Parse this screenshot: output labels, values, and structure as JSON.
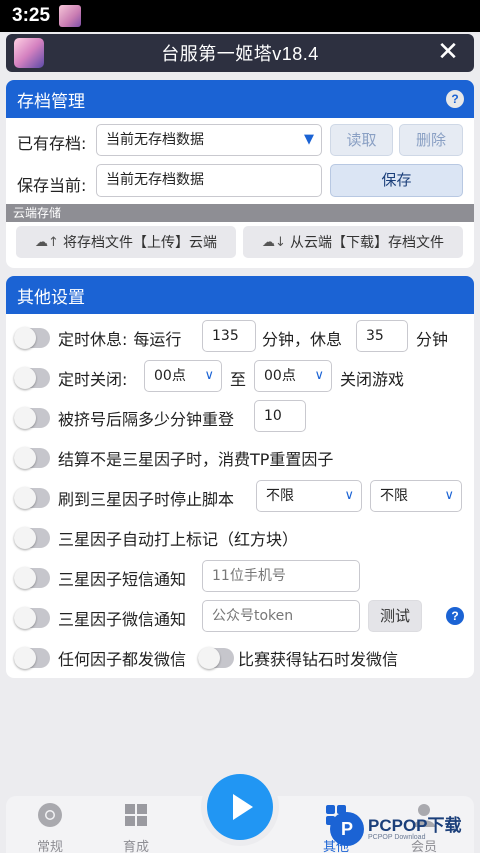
{
  "status_bar": {
    "time": "3:25"
  },
  "titlebar": {
    "title": "台服第一姬塔v18.4",
    "close_glyph": "✕"
  },
  "save_panel": {
    "title": "存档管理",
    "existing_label": "已有存档:",
    "existing_value": "当前无存档数据",
    "read_button": "读取",
    "delete_button": "删除",
    "save_current_label": "保存当前:",
    "save_current_value": "当前无存档数据",
    "save_button": "保存",
    "cloud_title": "云端存储",
    "upload_button": "将存档文件【上传】云端",
    "download_button": "从云端【下载】存档文件"
  },
  "other_panel": {
    "title": "其他设置",
    "timed_rest": {
      "label": "定时休息:",
      "every_label": "每运行",
      "run_minutes": "135",
      "minutes_rest_label": "分钟，休息",
      "rest_minutes": "35",
      "minutes_label": "分钟"
    },
    "timed_close": {
      "label": "定时关闭:",
      "from_value": "00点",
      "to_label": "至",
      "to_value": "00点",
      "suffix": "关闭游戏"
    },
    "relogin": {
      "label": "被挤号后隔多少分钟重登",
      "value": "10"
    },
    "settlement": {
      "label": "结算不是三星因子时，消费TP重置因子"
    },
    "stop_script": {
      "label": "刷到三星因子时停止脚本",
      "option1": "不限",
      "option2": "不限"
    },
    "auto_mark": {
      "label": "三星因子自动打上标记（红方块）"
    },
    "sms_notify": {
      "label": "三星因子短信通知",
      "placeholder": "11位手机号"
    },
    "wechat_notify": {
      "label": "三星因子微信通知",
      "placeholder": "公众号token",
      "test_button": "测试"
    },
    "any_factor": {
      "label": "任何因子都发微信"
    },
    "diamond": {
      "label": "比赛获得钻石时发微信"
    }
  },
  "bottom_nav": {
    "items": [
      {
        "label": "常规"
      },
      {
        "label": "育成"
      },
      {
        "label": "其他"
      },
      {
        "label": "会员"
      }
    ]
  },
  "watermark": {
    "logo": "P",
    "text": "PCPOP下载",
    "sub": "PCPOP Download"
  },
  "colors": {
    "primary": "#1b63d4",
    "titlebar": "#2d3040",
    "play": "#2196f3"
  }
}
